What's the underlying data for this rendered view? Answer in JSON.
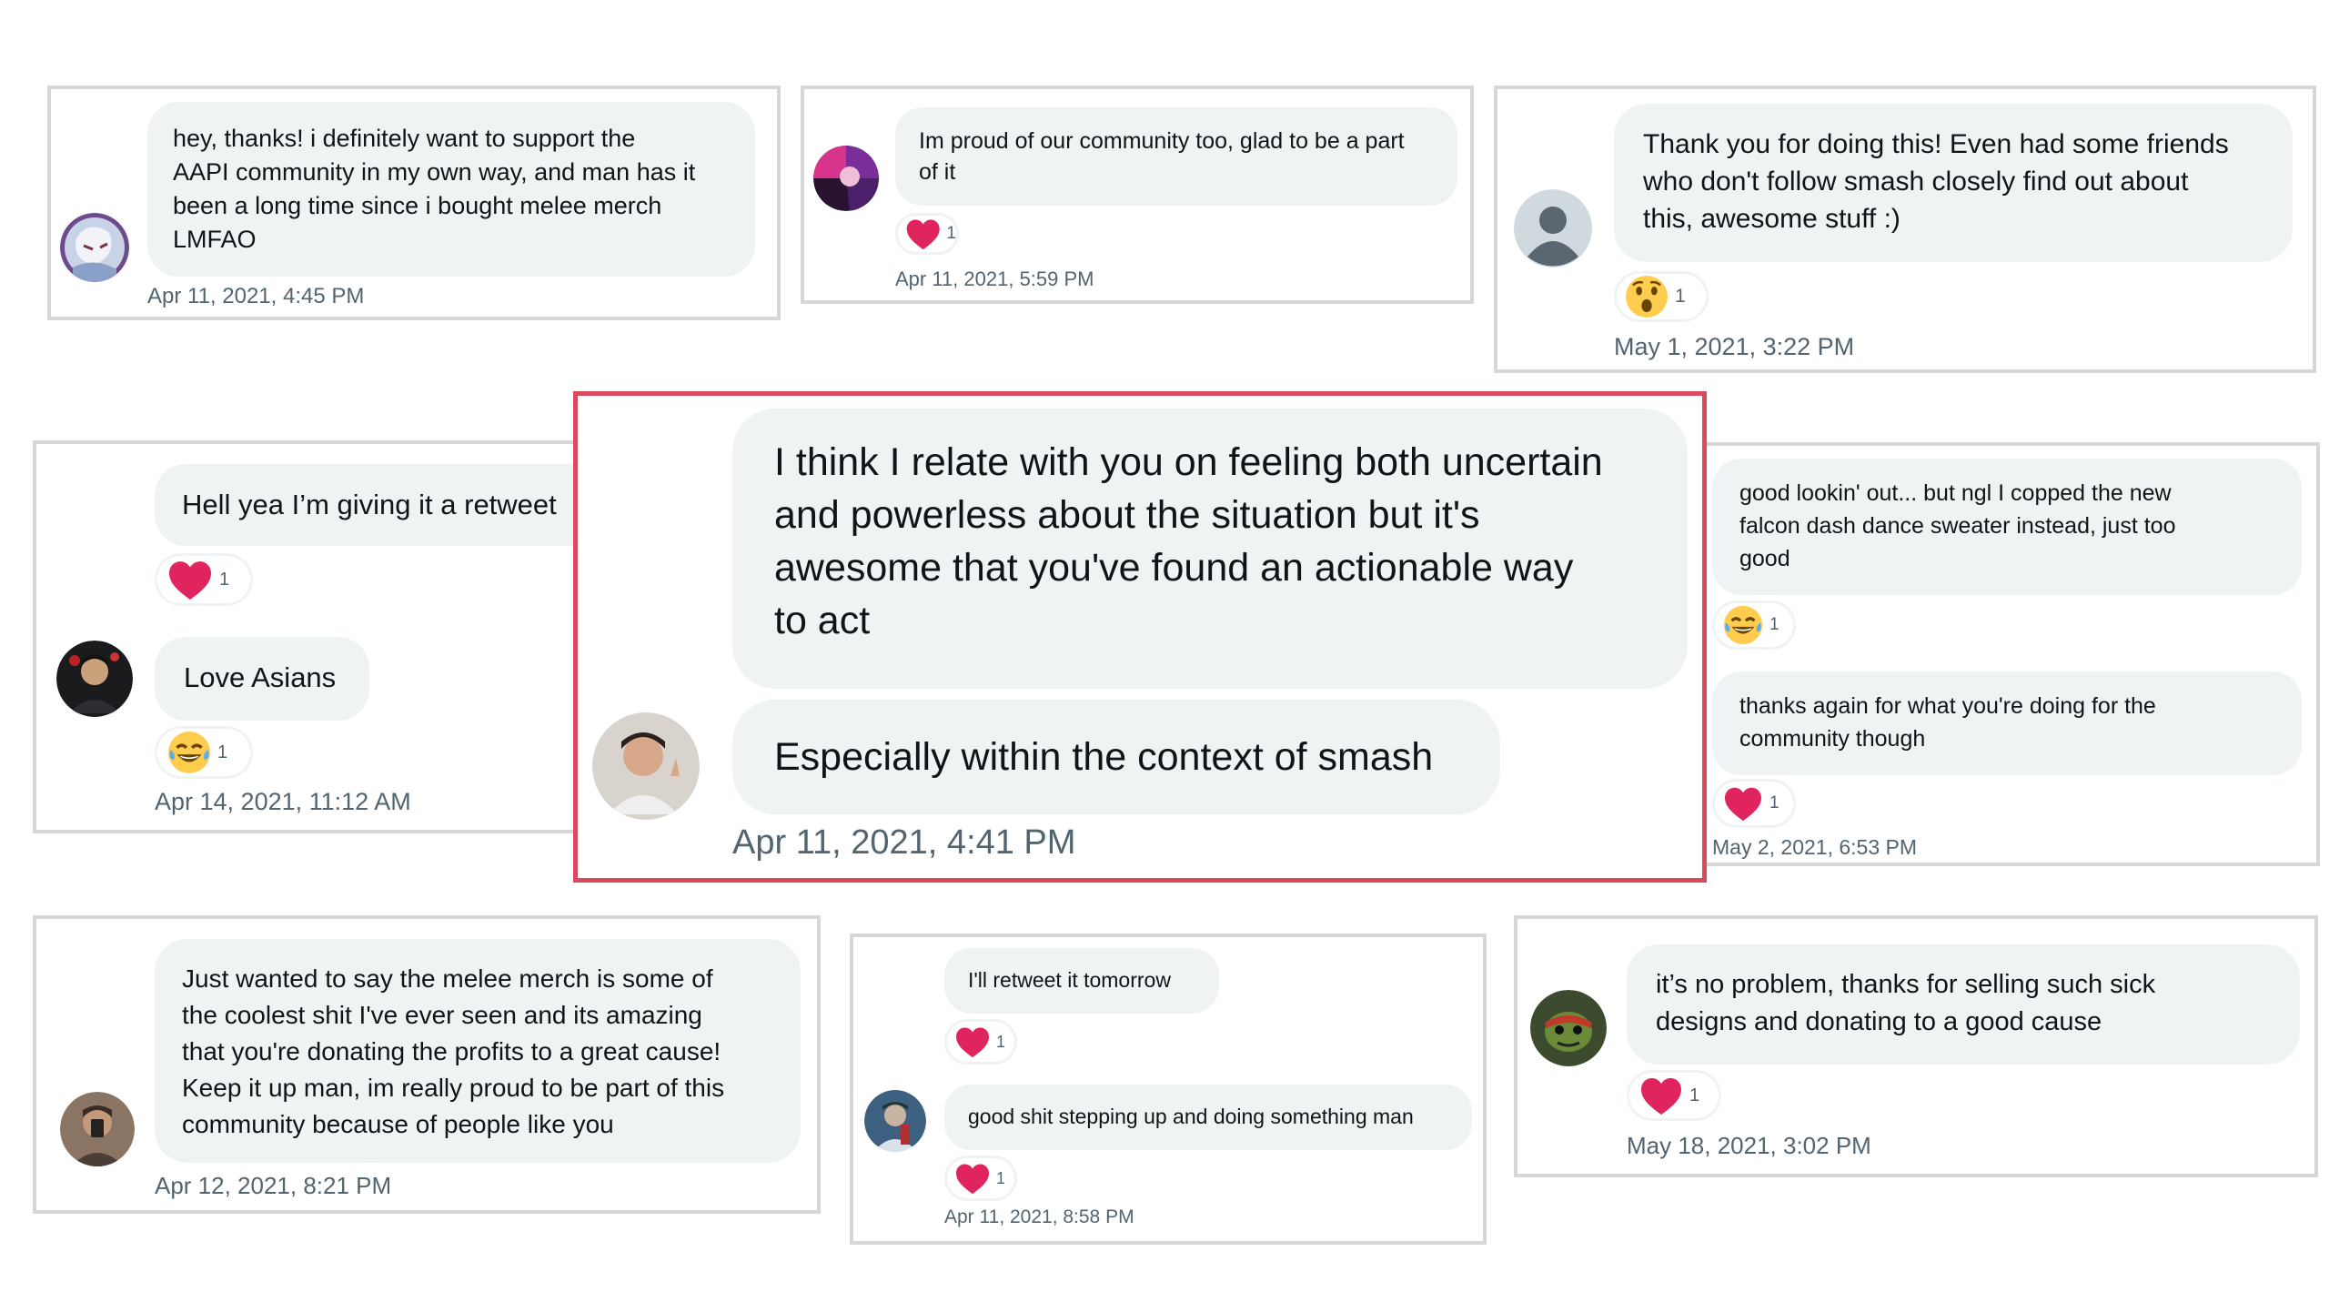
{
  "icons": {
    "heart": "heart-icon",
    "laugh": "laughing-emoji-icon",
    "wow": "surprised-emoji-icon"
  },
  "colors": {
    "featured_border": "#d94a5f",
    "bubble": "#eff3f4",
    "heart": "#f4212e",
    "timestamp": "#536471"
  },
  "dms": [
    {
      "id": "dm1",
      "lines": [
        "hey, thanks! i definitely want to support the",
        "AAPI community in my own way, and man has it",
        "been a long time since i bought melee merch",
        "LMFAO"
      ],
      "timestamp": "Apr 11, 2021, 4:45 PM"
    },
    {
      "id": "dm2",
      "lines": [
        "Im proud of our community too, glad to be a part",
        "of it"
      ],
      "reaction": {
        "type": "heart",
        "count": "1"
      },
      "timestamp": "Apr 11, 2021, 5:59 PM"
    },
    {
      "id": "dm3",
      "lines": [
        "Thank you for doing this! Even had some friends",
        "who don't follow smash closely find out about",
        "this, awesome stuff :)"
      ],
      "reaction": {
        "type": "wow",
        "count": "1"
      },
      "timestamp": "May 1, 2021, 3:22 PM"
    },
    {
      "id": "dm4",
      "messages": [
        {
          "text": "Hell yea I’m giving it a retweet",
          "reaction": {
            "type": "heart",
            "count": "1"
          }
        },
        {
          "text": "Love Asians",
          "reaction": {
            "type": "laugh",
            "count": "1"
          }
        }
      ],
      "timestamp": "Apr 14, 2021, 11:12 AM"
    },
    {
      "id": "dm5",
      "lines": [
        "I think I relate with you on feeling both uncertain",
        "and powerless about the situation but it's",
        "awesome that you've found an actionable way",
        "to act"
      ],
      "second": "Especially within the context of smash",
      "timestamp": "Apr 11, 2021, 4:41 PM"
    },
    {
      "id": "dm6",
      "messages": [
        {
          "lines": [
            "good lookin' out... but ngl I copped the new",
            "falcon dash dance sweater instead, just too",
            "good"
          ],
          "reaction": {
            "type": "laugh",
            "count": "1"
          }
        },
        {
          "lines": [
            "thanks again for what you're doing for the",
            "community though"
          ],
          "reaction": {
            "type": "heart",
            "count": "1"
          }
        }
      ],
      "timestamp": "May 2, 2021, 6:53 PM"
    },
    {
      "id": "dm7",
      "lines": [
        "Just wanted to say the melee merch is some of",
        "the coolest shit I've ever seen and its amazing",
        "that you're donating the profits to a great cause!",
        "Keep it up man, im really proud to be part of this",
        "community because of people like you"
      ],
      "timestamp": "Apr 12, 2021, 8:21 PM"
    },
    {
      "id": "dm8",
      "messages": [
        {
          "text": "I'll retweet it tomorrow",
          "reaction": {
            "type": "heart",
            "count": "1"
          }
        },
        {
          "text": "good shit stepping up and doing something man",
          "reaction": {
            "type": "heart",
            "count": "1"
          }
        }
      ],
      "timestamp": "Apr 11, 2021, 8:58 PM"
    },
    {
      "id": "dm9",
      "lines": [
        "it’s no problem, thanks for selling such sick",
        "designs and donating to a good cause"
      ],
      "reaction": {
        "type": "heart",
        "count": "1"
      },
      "timestamp": "May 18, 2021, 3:02 PM"
    }
  ]
}
